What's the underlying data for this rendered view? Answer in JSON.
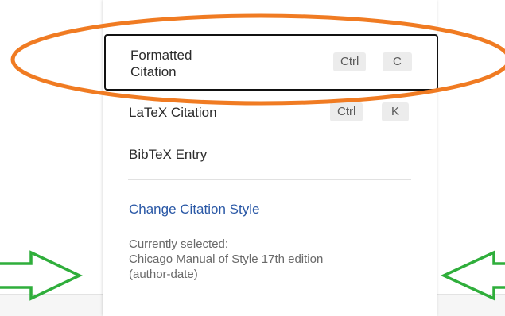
{
  "menu": {
    "formatted_citation": {
      "label_line1": "Formatted",
      "label_line2": "Citation",
      "shortcut_mod": "Ctrl",
      "shortcut_key": "C"
    },
    "latex_citation": {
      "label": "LaTeX Citation",
      "shortcut_mod": "Ctrl",
      "shortcut_key": "K"
    },
    "bibtex_entry": {
      "label": "BibTeX Entry"
    },
    "change_style": {
      "label": "Change Citation Style"
    },
    "current_selection": {
      "line1": "Currently selected:",
      "line2": "Chicago Manual of Style 17th edition",
      "line3": "(author-date)"
    }
  },
  "annotations": {
    "ellipse_color": "#f07b22",
    "arrow_color": "#2fae3b"
  }
}
